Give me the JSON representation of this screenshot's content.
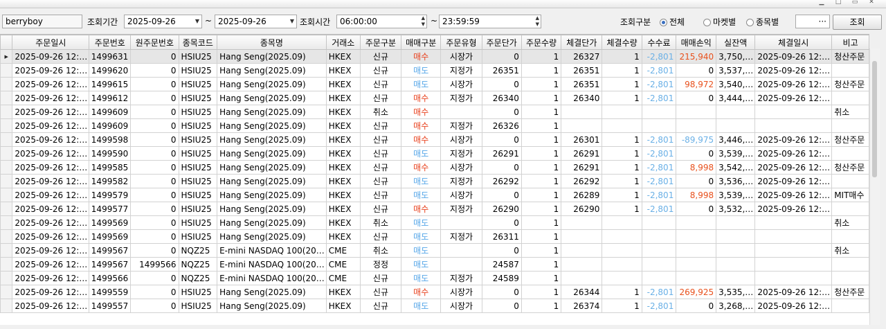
{
  "toolbar": {
    "user_id": "berryboy",
    "period_label": "조회기간",
    "date_from": "2025-09-26",
    "date_sep": "~",
    "date_to": "2025-09-26",
    "time_label": "조회시간",
    "time_from": "06:00:00",
    "time_sep": "~",
    "time_to": "23:59:59",
    "type_label": "조회구분",
    "radio_all": "전체",
    "radio_market": "마켓별",
    "radio_symbol": "종목별",
    "selected_radio": "전체",
    "extra_field_button": "···",
    "search_button": "조회"
  },
  "grid": {
    "columns": [
      "주문일시",
      "주문번호",
      "원주문번호",
      "종목코드",
      "종목명",
      "거래소",
      "주문구분",
      "매매구분",
      "주문유형",
      "주문단가",
      "주문수량",
      "체결단가",
      "체결수량",
      "수수료",
      "매매손익",
      "실잔액",
      "체결일시",
      "비고"
    ],
    "rows": [
      {
        "dt": "2025-09-26 12:…",
        "no": "1499631",
        "orig": "0",
        "code": "HSIU25",
        "name": "Hang Seng(2025.09)",
        "ex": "HKEX",
        "kind": "신규",
        "side": "매수",
        "type": "시장가",
        "price": "0",
        "qty": "1",
        "fprice": "26327",
        "fqty": "1",
        "fee": "-2,801",
        "pnl": "215,940",
        "pnl_sign": "pos",
        "bal": "3,750,…",
        "fdt": "2025-09-26 12:…",
        "note": "청산주문"
      },
      {
        "dt": "2025-09-26 12:…",
        "no": "1499620",
        "orig": "0",
        "code": "HSIU25",
        "name": "Hang Seng(2025.09)",
        "ex": "HKEX",
        "kind": "신규",
        "side": "매도",
        "type": "지정가",
        "price": "26351",
        "qty": "1",
        "fprice": "26351",
        "fqty": "1",
        "fee": "-2,801",
        "pnl": "0",
        "pnl_sign": "zero",
        "bal": "3,537,…",
        "fdt": "2025-09-26 12:…",
        "note": ""
      },
      {
        "dt": "2025-09-26 12:…",
        "no": "1499615",
        "orig": "0",
        "code": "HSIU25",
        "name": "Hang Seng(2025.09)",
        "ex": "HKEX",
        "kind": "신규",
        "side": "매도",
        "type": "시장가",
        "price": "0",
        "qty": "1",
        "fprice": "26351",
        "fqty": "1",
        "fee": "-2,801",
        "pnl": "98,972",
        "pnl_sign": "pos",
        "bal": "3,540,…",
        "fdt": "2025-09-26 12:…",
        "note": "청산주문"
      },
      {
        "dt": "2025-09-26 12:…",
        "no": "1499612",
        "orig": "0",
        "code": "HSIU25",
        "name": "Hang Seng(2025.09)",
        "ex": "HKEX",
        "kind": "신규",
        "side": "매수",
        "type": "지정가",
        "price": "26340",
        "qty": "1",
        "fprice": "26340",
        "fqty": "1",
        "fee": "-2,801",
        "pnl": "0",
        "pnl_sign": "zero",
        "bal": "3,444,…",
        "fdt": "2025-09-26 12:…",
        "note": ""
      },
      {
        "dt": "2025-09-26 12:…",
        "no": "1499609",
        "orig": "0",
        "code": "HSIU25",
        "name": "Hang Seng(2025.09)",
        "ex": "HKEX",
        "kind": "취소",
        "side": "매수",
        "type": "",
        "price": "0",
        "qty": "1",
        "fprice": "",
        "fqty": "",
        "fee": "",
        "pnl": "",
        "pnl_sign": "zero",
        "bal": "",
        "fdt": "",
        "note": "취소"
      },
      {
        "dt": "2025-09-26 12:…",
        "no": "1499609",
        "orig": "0",
        "code": "HSIU25",
        "name": "Hang Seng(2025.09)",
        "ex": "HKEX",
        "kind": "신규",
        "side": "매수",
        "type": "지정가",
        "price": "26326",
        "qty": "1",
        "fprice": "",
        "fqty": "",
        "fee": "",
        "pnl": "",
        "pnl_sign": "zero",
        "bal": "",
        "fdt": "",
        "note": ""
      },
      {
        "dt": "2025-09-26 12:…",
        "no": "1499598",
        "orig": "0",
        "code": "HSIU25",
        "name": "Hang Seng(2025.09)",
        "ex": "HKEX",
        "kind": "신규",
        "side": "매수",
        "type": "시장가",
        "price": "0",
        "qty": "1",
        "fprice": "26301",
        "fqty": "1",
        "fee": "-2,801",
        "pnl": "-89,975",
        "pnl_sign": "neg",
        "bal": "3,446,…",
        "fdt": "2025-09-26 12:…",
        "note": "청산주문"
      },
      {
        "dt": "2025-09-26 12:…",
        "no": "1499590",
        "orig": "0",
        "code": "HSIU25",
        "name": "Hang Seng(2025.09)",
        "ex": "HKEX",
        "kind": "신규",
        "side": "매도",
        "type": "지정가",
        "price": "26291",
        "qty": "1",
        "fprice": "26291",
        "fqty": "1",
        "fee": "-2,801",
        "pnl": "0",
        "pnl_sign": "zero",
        "bal": "3,539,…",
        "fdt": "2025-09-26 12:…",
        "note": ""
      },
      {
        "dt": "2025-09-26 12:…",
        "no": "1499585",
        "orig": "0",
        "code": "HSIU25",
        "name": "Hang Seng(2025.09)",
        "ex": "HKEX",
        "kind": "신규",
        "side": "매수",
        "type": "시장가",
        "price": "0",
        "qty": "1",
        "fprice": "26291",
        "fqty": "1",
        "fee": "-2,801",
        "pnl": "8,998",
        "pnl_sign": "pos",
        "bal": "3,542,…",
        "fdt": "2025-09-26 12:…",
        "note": "청산주문"
      },
      {
        "dt": "2025-09-26 12:…",
        "no": "1499582",
        "orig": "0",
        "code": "HSIU25",
        "name": "Hang Seng(2025.09)",
        "ex": "HKEX",
        "kind": "신규",
        "side": "매도",
        "type": "지정가",
        "price": "26292",
        "qty": "1",
        "fprice": "26292",
        "fqty": "1",
        "fee": "-2,801",
        "pnl": "0",
        "pnl_sign": "zero",
        "bal": "3,536,…",
        "fdt": "2025-09-26 12:…",
        "note": ""
      },
      {
        "dt": "2025-09-26 12:…",
        "no": "1499579",
        "orig": "0",
        "code": "HSIU25",
        "name": "Hang Seng(2025.09)",
        "ex": "HKEX",
        "kind": "신규",
        "side": "매도",
        "type": "시장가",
        "price": "0",
        "qty": "1",
        "fprice": "26289",
        "fqty": "1",
        "fee": "-2,801",
        "pnl": "8,998",
        "pnl_sign": "pos",
        "bal": "3,539,…",
        "fdt": "2025-09-26 12:…",
        "note": "MIT매수"
      },
      {
        "dt": "2025-09-26 12:…",
        "no": "1499577",
        "orig": "0",
        "code": "HSIU25",
        "name": "Hang Seng(2025.09)",
        "ex": "HKEX",
        "kind": "신규",
        "side": "매수",
        "type": "지정가",
        "price": "26290",
        "qty": "1",
        "fprice": "26290",
        "fqty": "1",
        "fee": "-2,801",
        "pnl": "0",
        "pnl_sign": "zero",
        "bal": "3,532,…",
        "fdt": "2025-09-26 12:…",
        "note": ""
      },
      {
        "dt": "2025-09-26 12:…",
        "no": "1499569",
        "orig": "0",
        "code": "HSIU25",
        "name": "Hang Seng(2025.09)",
        "ex": "HKEX",
        "kind": "취소",
        "side": "매도",
        "type": "",
        "price": "0",
        "qty": "1",
        "fprice": "",
        "fqty": "",
        "fee": "",
        "pnl": "",
        "pnl_sign": "zero",
        "bal": "",
        "fdt": "",
        "note": "취소"
      },
      {
        "dt": "2025-09-26 12:…",
        "no": "1499569",
        "orig": "0",
        "code": "HSIU25",
        "name": "Hang Seng(2025.09)",
        "ex": "HKEX",
        "kind": "신규",
        "side": "매도",
        "type": "지정가",
        "price": "26311",
        "qty": "1",
        "fprice": "",
        "fqty": "",
        "fee": "",
        "pnl": "",
        "pnl_sign": "zero",
        "bal": "",
        "fdt": "",
        "note": ""
      },
      {
        "dt": "2025-09-26 12:…",
        "no": "1499567",
        "orig": "0",
        "code": "NQZ25",
        "name": "E-mini NASDAQ 100(20…",
        "ex": "CME",
        "kind": "취소",
        "side": "매도",
        "type": "",
        "price": "0",
        "qty": "1",
        "fprice": "",
        "fqty": "",
        "fee": "",
        "pnl": "",
        "pnl_sign": "zero",
        "bal": "",
        "fdt": "",
        "note": "취소"
      },
      {
        "dt": "2025-09-26 12:…",
        "no": "1499567",
        "orig": "1499566",
        "code": "NQZ25",
        "name": "E-mini NASDAQ 100(20…",
        "ex": "CME",
        "kind": "정정",
        "side": "매도",
        "type": "",
        "price": "24587",
        "qty": "1",
        "fprice": "",
        "fqty": "",
        "fee": "",
        "pnl": "",
        "pnl_sign": "zero",
        "bal": "",
        "fdt": "",
        "note": ""
      },
      {
        "dt": "2025-09-26 12:…",
        "no": "1499566",
        "orig": "0",
        "code": "NQZ25",
        "name": "E-mini NASDAQ 100(20…",
        "ex": "CME",
        "kind": "신규",
        "side": "매도",
        "type": "지정가",
        "price": "24589",
        "qty": "1",
        "fprice": "",
        "fqty": "",
        "fee": "",
        "pnl": "",
        "pnl_sign": "zero",
        "bal": "",
        "fdt": "",
        "note": ""
      },
      {
        "dt": "2025-09-26 12:…",
        "no": "1499559",
        "orig": "0",
        "code": "HSIU25",
        "name": "Hang Seng(2025.09)",
        "ex": "HKEX",
        "kind": "신규",
        "side": "매수",
        "type": "시장가",
        "price": "0",
        "qty": "1",
        "fprice": "26344",
        "fqty": "1",
        "fee": "-2,801",
        "pnl": "269,925",
        "pnl_sign": "pos",
        "bal": "3,535,…",
        "fdt": "2025-09-26 12:…",
        "note": "청산주문"
      },
      {
        "dt": "2025-09-26 12:…",
        "no": "1499557",
        "orig": "0",
        "code": "HSIU25",
        "name": "Hang Seng(2025.09)",
        "ex": "HKEX",
        "kind": "신규",
        "side": "매도",
        "type": "시장가",
        "price": "0",
        "qty": "1",
        "fprice": "26374",
        "fqty": "1",
        "fee": "-2,801",
        "pnl": "0",
        "pnl_sign": "zero",
        "bal": "3,268,…",
        "fdt": "2025-09-26 12:…",
        "note": ""
      }
    ]
  },
  "icons": {
    "date_dropdown": "chevron-down-icon",
    "time_spinner": "spinner-icon",
    "row_indicator": "row-pointer-icon"
  },
  "colors": {
    "buy": "#e8401c",
    "sell": "#55a6e8",
    "profit": "#e8501c",
    "loss": "#6ab0e6",
    "selected_row": "#e6e6e6"
  }
}
